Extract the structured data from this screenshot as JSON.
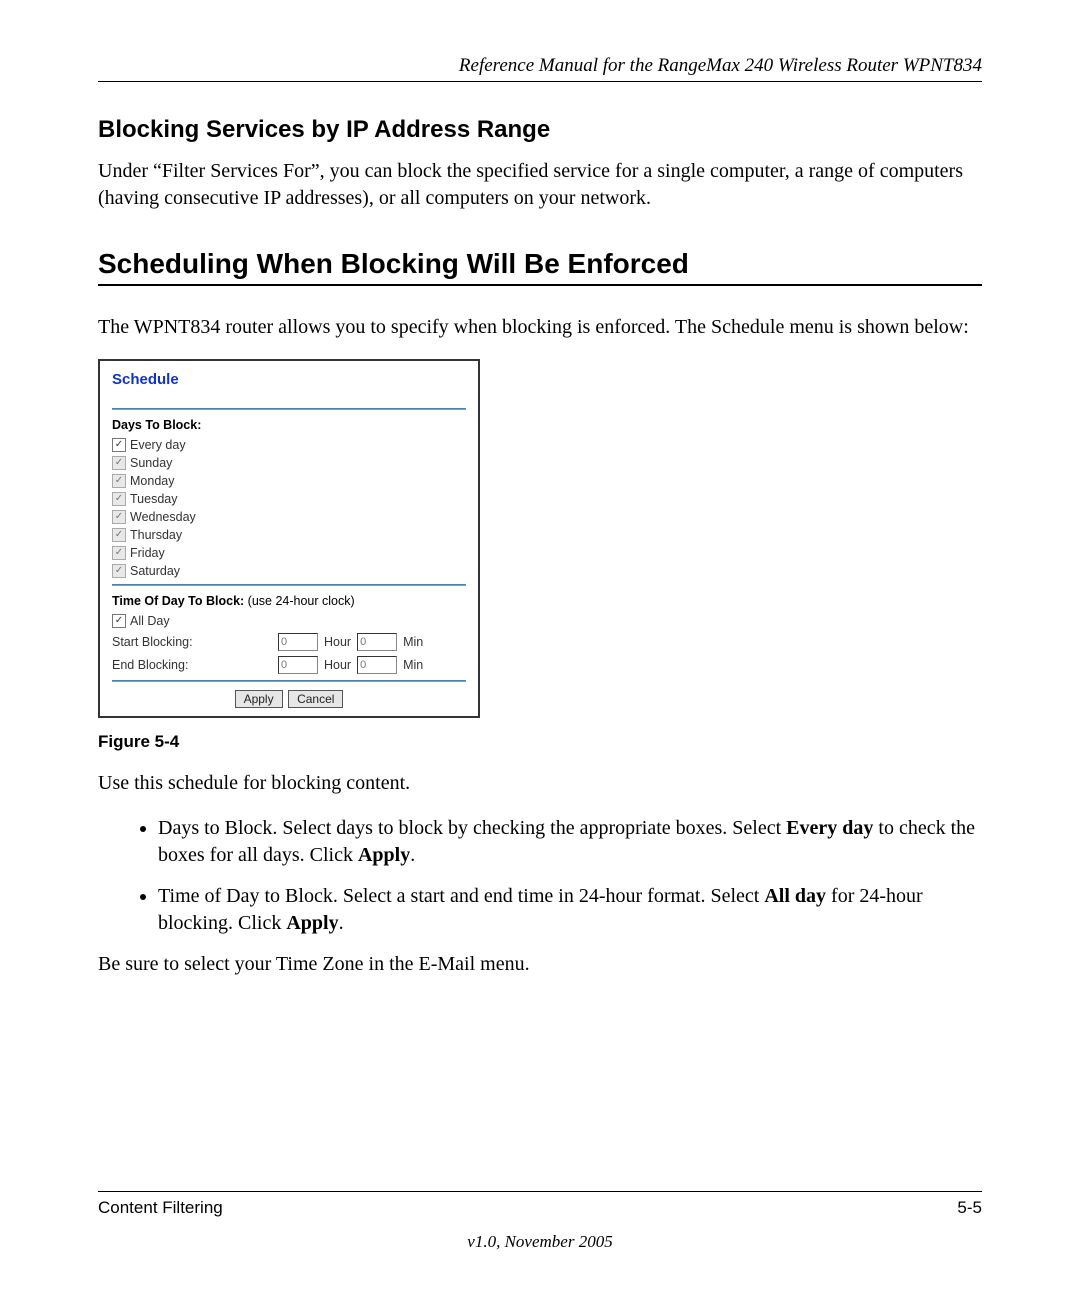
{
  "header": {
    "title": "Reference Manual for the RangeMax 240 Wireless Router WPNT834"
  },
  "section1": {
    "heading": "Blocking Services by IP Address Range",
    "para": "Under “Filter Services For”, you can block the specified service for a single computer, a range of computers (having consecutive IP addresses), or all computers on your network."
  },
  "section2": {
    "heading": "Scheduling When Blocking Will Be Enforced",
    "intro": "The WPNT834 router allows you to specify when blocking is enforced. The Schedule menu is shown below:"
  },
  "panel": {
    "title": "Schedule",
    "days_heading": "Days To Block:",
    "days": [
      {
        "label": "Every day",
        "checked": true,
        "disabled": false
      },
      {
        "label": "Sunday",
        "checked": true,
        "disabled": true
      },
      {
        "label": "Monday",
        "checked": true,
        "disabled": true
      },
      {
        "label": "Tuesday",
        "checked": true,
        "disabled": true
      },
      {
        "label": "Wednesday",
        "checked": true,
        "disabled": true
      },
      {
        "label": "Thursday",
        "checked": true,
        "disabled": true
      },
      {
        "label": "Friday",
        "checked": true,
        "disabled": true
      },
      {
        "label": "Saturday",
        "checked": true,
        "disabled": true
      }
    ],
    "time_heading_bold": "Time Of Day To Block:",
    "time_heading_note": " (use 24-hour clock)",
    "allday_label": "All Day",
    "allday_checked": true,
    "start_label": "Start Blocking:",
    "end_label": "End Blocking:",
    "hour_label": "Hour",
    "min_label": "Min",
    "start_hour": "0",
    "start_min": "0",
    "end_hour": "0",
    "end_min": "0",
    "apply_label": "Apply",
    "cancel_label": "Cancel"
  },
  "figure_caption": "Figure 5-4",
  "after_figure": "Use this schedule for blocking content.",
  "bullets": {
    "b1_pre": "Days to Block. Select days to block by checking the appropriate boxes. Select ",
    "b1_bold1": "Every day",
    "b1_mid": " to check the boxes for all days. Click ",
    "b1_bold2": "Apply",
    "b1_end": ".",
    "b2_pre": "Time of Day to Block. Select a start and end time in 24-hour format. Select ",
    "b2_bold1": "All day",
    "b2_mid": " for 24-hour blocking. Click ",
    "b2_bold2": "Apply",
    "b2_end": "."
  },
  "closing": "Be sure to select your Time Zone in the E-Mail menu.",
  "footer": {
    "left": "Content Filtering",
    "right": "5-5",
    "version": "v1.0, November 2005"
  }
}
